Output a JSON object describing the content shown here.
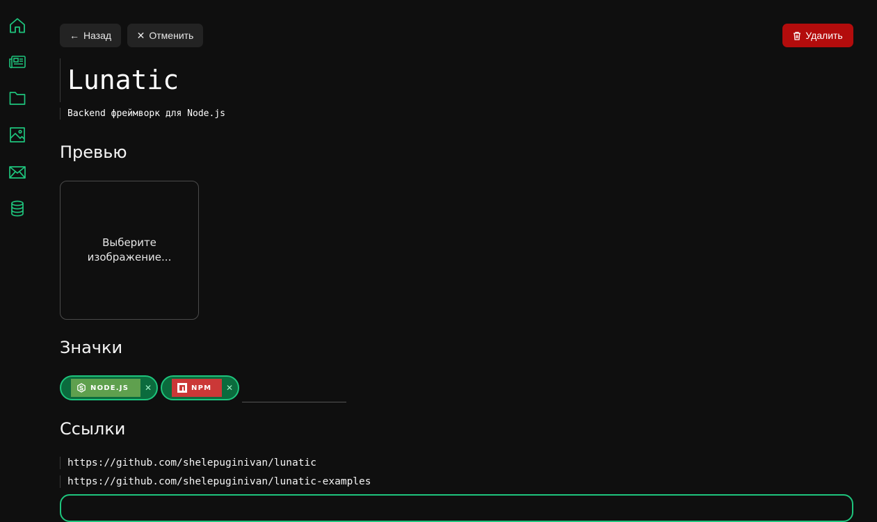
{
  "sidebar": {
    "accent": "#1ec57d",
    "items": [
      {
        "icon": "home-icon"
      },
      {
        "icon": "news-icon"
      },
      {
        "icon": "folder-icon"
      },
      {
        "icon": "image-icon"
      },
      {
        "icon": "mail-icon"
      },
      {
        "icon": "database-icon"
      }
    ]
  },
  "toolbar": {
    "back_label": "Назад",
    "cancel_label": "Отменить",
    "delete_label": "Удалить",
    "delete_color": "#b30c0c"
  },
  "project": {
    "title": "Lunatic",
    "subtitle": "Backend фреймворк для Node.js"
  },
  "preview": {
    "heading": "Превью",
    "placeholder": "Выберите изображение..."
  },
  "badges": {
    "heading": "Значки",
    "items": [
      {
        "label": "NODE.JS",
        "color": "#5fa04e",
        "icon": "nodejs-icon"
      },
      {
        "label": "NPM",
        "color": "#cb3837",
        "icon": "npm-icon"
      }
    ]
  },
  "links": {
    "heading": "Ссылки",
    "items": [
      "https://github.com/shelepuginivan/lunatic",
      "https://github.com/shelepuginivan/lunatic-examples"
    ]
  }
}
